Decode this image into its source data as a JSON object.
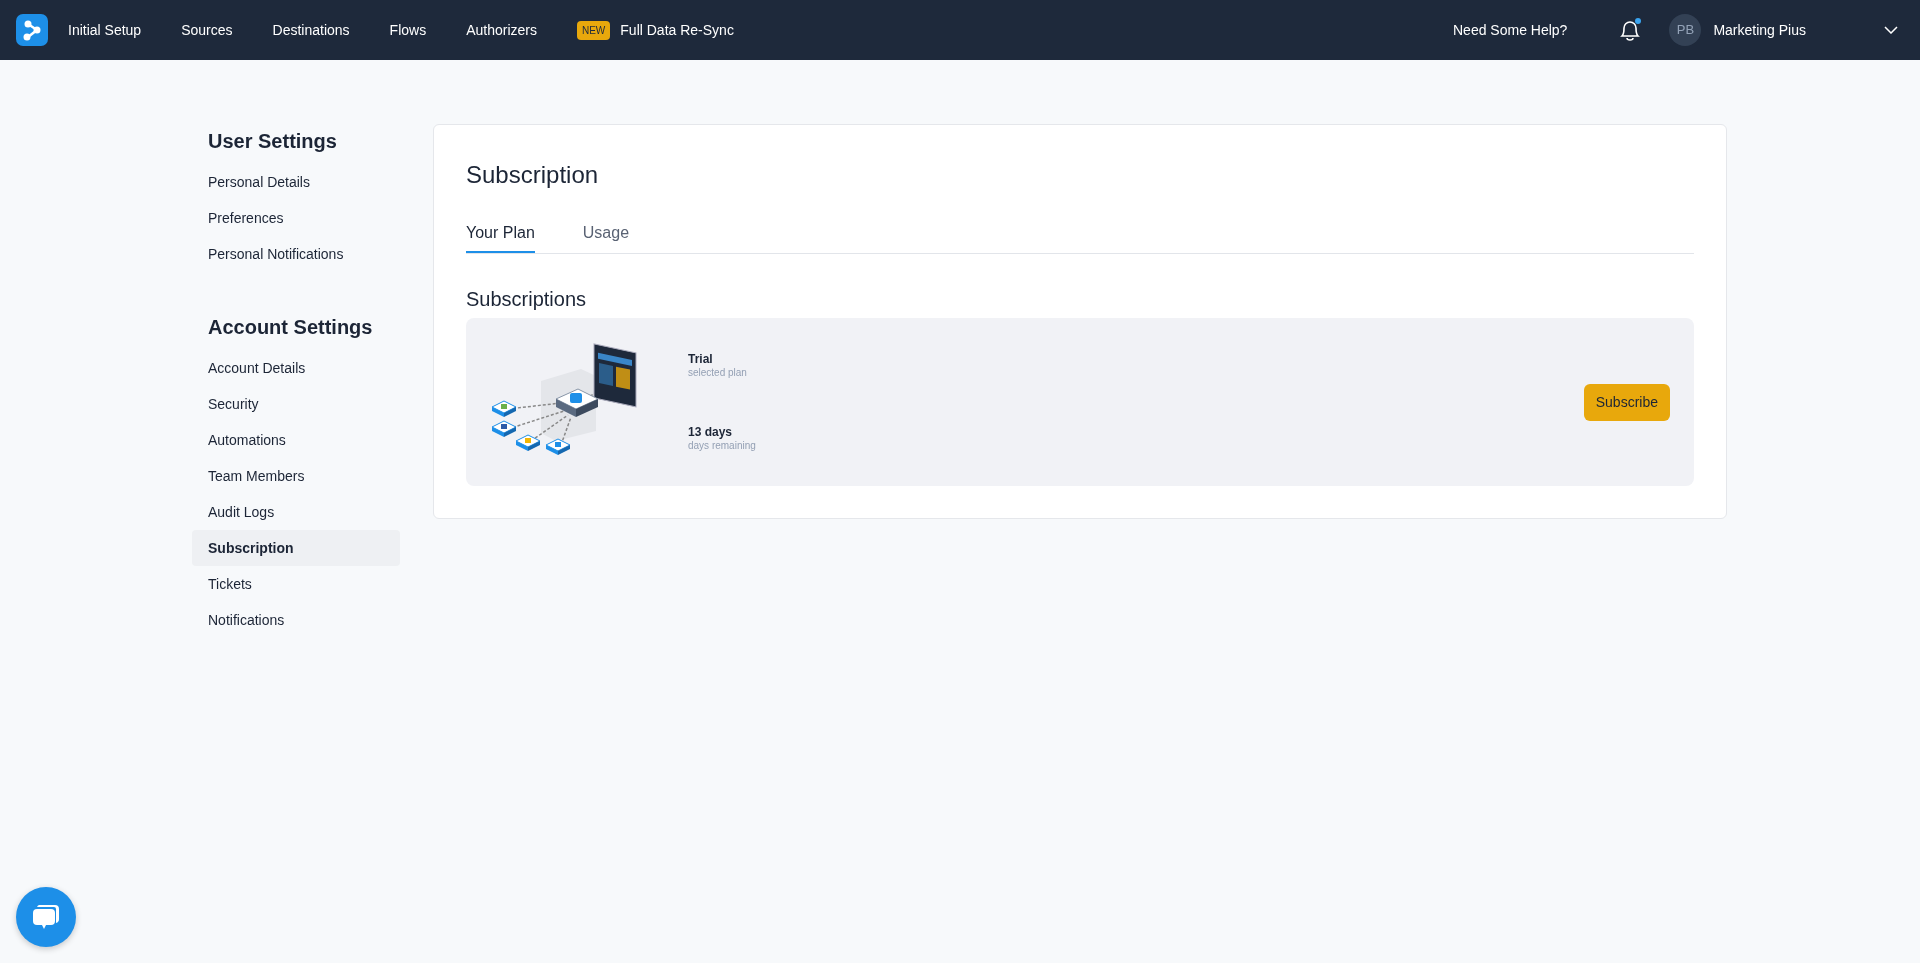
{
  "navbar": {
    "items": [
      {
        "label": "Initial Setup"
      },
      {
        "label": "Sources"
      },
      {
        "label": "Destinations"
      },
      {
        "label": "Flows"
      },
      {
        "label": "Authorizers"
      },
      {
        "label": "Full Data Re-Sync",
        "badge": "NEW"
      }
    ],
    "help": "Need Some Help?",
    "notifications_unread": true,
    "user": {
      "initials": "PB",
      "name": "Marketing Pius"
    }
  },
  "sidebar": {
    "sections": [
      {
        "title": "User Settings",
        "items": [
          {
            "label": "Personal Details",
            "selected": false
          },
          {
            "label": "Preferences",
            "selected": false
          },
          {
            "label": "Personal Notifications",
            "selected": false
          }
        ]
      },
      {
        "title": "Account Settings",
        "items": [
          {
            "label": "Account Details",
            "selected": false
          },
          {
            "label": "Security",
            "selected": false
          },
          {
            "label": "Automations",
            "selected": false
          },
          {
            "label": "Team Members",
            "selected": false
          },
          {
            "label": "Audit Logs",
            "selected": false
          },
          {
            "label": "Subscription",
            "selected": true
          },
          {
            "label": "Tickets",
            "selected": false
          },
          {
            "label": "Notifications",
            "selected": false
          }
        ]
      }
    ]
  },
  "page": {
    "title": "Subscription",
    "tabs": [
      {
        "label": "Your Plan",
        "selected": true
      },
      {
        "label": "Usage",
        "selected": false
      }
    ],
    "section_title": "Subscriptions",
    "plan": {
      "stats": [
        {
          "value": "Trial",
          "caption": "selected plan"
        },
        {
          "value": "13 days",
          "caption": "days remaining"
        }
      ],
      "button": "Subscribe"
    }
  }
}
